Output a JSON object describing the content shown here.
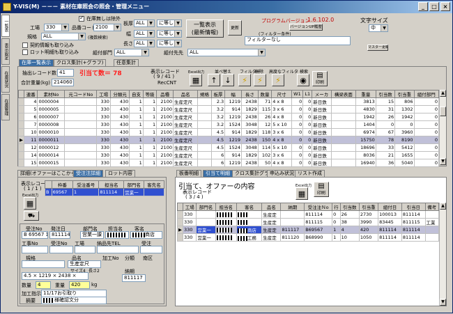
{
  "window": {
    "title": "Y-VIS(M) －－－ 素材在庫照会の照会・管理メニュー",
    "min": "_",
    "max": "□",
    "close": "×"
  },
  "side_tabs": [
    "一覧表",
    "表示設定",
    "在庫状況",
    "在庫管理"
  ],
  "filters": {
    "zaiko_chk_label": "在庫無しは除外",
    "kojo_label": "工場",
    "kojo_value": "330",
    "hinban_label": "品番コード",
    "hinban_value": "2100",
    "kikaku_label": "規格",
    "kikaku_value": "ALL",
    "kikaku_note": "(複数検索)",
    "keiyaku_label": "契約情報も取り込み",
    "lot_label": "ロット明細も取り込み",
    "kumitate_label": "組付部門",
    "kumitate_value": "ALL",
    "kumisaki_label": "組付先先",
    "kumisaki_value": "ALL",
    "atsu_label": "板厚",
    "atsu_value": "ALL",
    "atsu_op": "に等しい",
    "haba_label": "幅",
    "haba_value": "ALL",
    "haba_op": "に等しい",
    "naga_label": "長さ",
    "naga_value": "ALL",
    "naga_op": "に等しい"
  },
  "buttons": {
    "list_show": "一覧表示\n(最新情報)",
    "update": "更新",
    "filter_cond_label": "(フィルター条件)",
    "filter_value": "フィルターなし",
    "version_label": "プログラムバージョン",
    "version_value": "1.6.102.0",
    "version_btn": "バージョンUP履歴",
    "font_label": "文字サイズ",
    "font_value": "中",
    "master_btn": "マスター更新"
  },
  "main_tabs": [
    "在庫一覧表示",
    "クロス集計(+グラフ)",
    "任意集計"
  ],
  "summary": {
    "extract_label": "抽出レコード数",
    "extract_value": "41",
    "hits_text": "引当て数＝ 78",
    "total_label": "合計重量(kg)",
    "total_value": "214060",
    "record_label": "表示レコード",
    "record_value": "( 9 / 41 )",
    "reccnt": "RecCNT",
    "excel_btn": "Excel出力",
    "sort_label": "並べ替え",
    "filter_label": "フィルター",
    "clear_label": "解除",
    "advfilter_label": "高度なフィルタ",
    "search_label": "検索",
    "print_label": "印刷"
  },
  "main_grid": {
    "headers": [
      "連番",
      "素材No",
      "元コードNo",
      "工場",
      "分類元",
      "自支",
      "等級",
      "品種",
      "品名",
      "規格",
      "板厚",
      "幅",
      "長さ",
      "数量",
      "尺寸",
      "W1",
      "L1",
      "メーカ",
      "構梁表面",
      "重量",
      "引当数",
      "引当重",
      "組付部門"
    ],
    "rows": [
      [
        "4",
        "0000004",
        "",
        "330",
        "430",
        "1",
        "1",
        "2100",
        "生産定尺",
        "",
        "2.3",
        "1219",
        "2438",
        "71",
        "4 x 8",
        "0",
        "0",
        "新日鉄",
        "",
        "3813",
        "15",
        "806",
        "0"
      ],
      [
        "5",
        "0000005",
        "",
        "330",
        "430",
        "1",
        "1",
        "2100",
        "生産定尺",
        "",
        "3.2",
        "914",
        "1829",
        "115",
        "3 x 6",
        "0",
        "0",
        "新日鉄",
        "",
        "4830",
        "31",
        "1302",
        "0"
      ],
      [
        "6",
        "0000007",
        "",
        "330",
        "430",
        "1",
        "1",
        "2100",
        "生産定尺",
        "",
        "3.2",
        "1219",
        "2438",
        "26",
        "4 x 8",
        "0",
        "0",
        "新日鉄",
        "",
        "1942",
        "26",
        "1942",
        "0"
      ],
      [
        "7",
        "0000008",
        "",
        "330",
        "430",
        "1",
        "1",
        "2100",
        "生産定尺",
        "",
        "3.2",
        "1524",
        "3048",
        "12",
        "5 x 10",
        "0",
        "0",
        "新日鉄",
        "",
        "1404",
        "0",
        "0",
        "0"
      ],
      [
        "10",
        "0000010",
        "",
        "330",
        "430",
        "1",
        "1",
        "2100",
        "生産定尺",
        "",
        "4.5",
        "914",
        "1829",
        "118",
        "3 x 6",
        "0",
        "0",
        "新日鉄",
        "",
        "6974",
        "67",
        "3960",
        "0"
      ],
      [
        "11",
        "0000011",
        "",
        "330",
        "430",
        "1",
        "1",
        "2100",
        "生産定尺",
        "",
        "4.5",
        "1219",
        "2438",
        "150",
        "4 x 8",
        "0",
        "0",
        "新日鉄",
        "",
        "15750",
        "78",
        "8190",
        "0"
      ],
      [
        "12",
        "0000012",
        "",
        "330",
        "430",
        "1",
        "1",
        "2100",
        "生産定尺",
        "",
        "4.5",
        "1524",
        "3048",
        "114",
        "5 x 10",
        "0",
        "0",
        "新日鉄",
        "",
        "18696",
        "33",
        "5412",
        "0"
      ],
      [
        "14",
        "0000014",
        "",
        "330",
        "430",
        "1",
        "1",
        "2100",
        "生産定尺",
        "",
        "6",
        "914",
        "1829",
        "102",
        "3 x 6",
        "0",
        "0",
        "新日鉄",
        "",
        "8036",
        "21",
        "1655",
        "0"
      ],
      [
        "15",
        "0000015",
        "",
        "330",
        "430",
        "1",
        "1",
        "2100",
        "生産定尺",
        "",
        "6",
        "1219",
        "2438",
        "50",
        "4 x 8",
        "0",
        "0",
        "新日鉄",
        "",
        "16940",
        "36",
        "5040",
        "0"
      ]
    ],
    "selected_index": 5
  },
  "detail": {
    "tabs": [
      "詳細(オファーはここから)",
      "受注注詳細",
      "ロット内容"
    ],
    "record_label": "表示レコード",
    "record_value": "( 1 / 1 )",
    "excel_btn": "Excel出力",
    "mini_headers": [
      "",
      "枠番",
      "受注番号",
      "担当名",
      "部門名",
      "客先名"
    ],
    "mini_row": [
      "B",
      "69567",
      "1",
      "811114",
      "営業一",
      ""
    ],
    "form": {
      "juchu_label": "受注No",
      "juchu_value": "B 69567 1",
      "hatchu_label": "発注日",
      "hatchu_value": "811114",
      "bumon_label": "部門名",
      "bumon_value": "営業一課",
      "tanto_label": "担当名",
      "kyaku_label": "客名",
      "kyaku_value": "商店",
      "kou_label": "工事No",
      "jutaku_label": "受注No",
      "koujo_label": "工場",
      "haiso_label": "納品先TEL",
      "kenchiku_label": "受注",
      "kikaku_label": "規格",
      "hinmei_label": "品名",
      "hinmei_value": "生産定尺",
      "note_label": "加工No",
      "bunrui_label": "分類",
      "nanpo_label": "南区",
      "size_label": "サイズ4",
      "cho_label": "長さ2",
      "dims": "4.5 × 1219 × 2438 ×",
      "nouki_label": "納期",
      "nouki_value": "811117",
      "suryo_label": "数量",
      "suryo_value": "4",
      "juryo_label": "重量",
      "juryo_value": "420",
      "juryo_unit": "kg",
      "kakou_label": "加工指示",
      "kakou_value": "11/17お引取り",
      "biko_label": "摘要",
      "biko_value": "様確認文分"
    }
  },
  "alloc": {
    "tabs": [
      "板番明細",
      "引当て明細",
      "クロス集計グラフ",
      "申込み状況",
      "リスト作成"
    ],
    "title": "引当て、オファーの内容",
    "record_label": "表示レコード",
    "record_value": "( 3 / 4 )",
    "excel_btn": "Excel出力",
    "print_btn": "印刷",
    "headers": [
      "",
      "工場",
      "部門名",
      "担当名",
      "客名",
      "品名",
      "納期",
      "受注注Ｎo",
      "行",
      "引当数",
      "引当重",
      "組付日",
      "引当日",
      "備考"
    ],
    "rows": [
      [
        "",
        "330",
        "",
        "",
        "",
        "生産定",
        "",
        "811114",
        "0",
        "26",
        "2730",
        "100013",
        "811114",
        ""
      ],
      [
        "",
        "330",
        "",
        "",
        "",
        "生産定",
        "",
        "811115",
        "0",
        "38",
        "3990",
        "83445",
        "811115",
        "工業"
      ],
      [
        "▶",
        "330",
        "営業一",
        "",
        "商店",
        "生産定",
        "811117",
        "B69567",
        "1",
        "4",
        "420",
        "811114",
        "811114",
        ""
      ],
      [
        "",
        "330",
        "営業一",
        "",
        "工務",
        "生産定",
        "811120",
        "B68990",
        "1",
        "10",
        "1050",
        "811114",
        "811114",
        ""
      ]
    ],
    "selected_index": 2
  }
}
